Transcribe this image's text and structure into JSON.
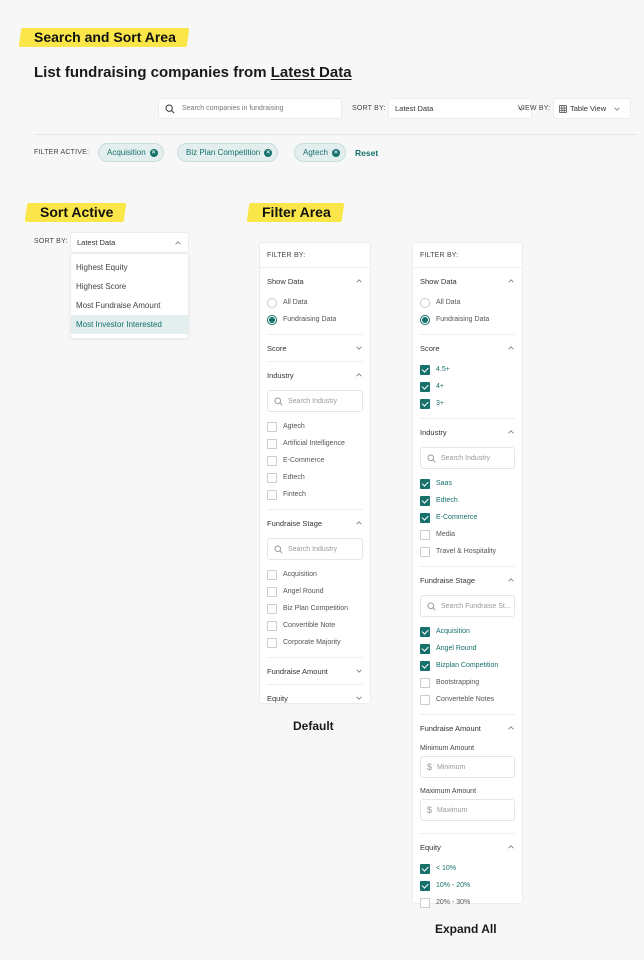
{
  "sections": {
    "search_sort_title": "Search and Sort Area",
    "sort_active_title": "Sort Active",
    "filter_area_title": "Filter Area"
  },
  "heading": {
    "prefix": "List fundraising companies from ",
    "link": "Latest Data"
  },
  "toolbar": {
    "search_placeholder": "Search companies in fundraising",
    "sort_label": "SORT BY:",
    "sort_value": "Latest Data",
    "view_label": "VIEW BY:",
    "view_value": "Table View"
  },
  "active_filters": {
    "label": "FILTER ACTIVE:",
    "chips": [
      "Acquisition",
      "Biz Plan Competition",
      "Agtech"
    ],
    "reset_label": "Reset"
  },
  "sort_active": {
    "label": "SORT BY:",
    "value": "Latest Data",
    "options": [
      "Highest Equity",
      "Highest Score",
      "Most Fundraise Amount",
      "Most Investor Interested"
    ],
    "selected_index": 3
  },
  "filter_default": {
    "header": "FILTER BY:",
    "show_data": {
      "title": "Show Data",
      "options": [
        "All Data",
        "Fundraising Data"
      ],
      "selected": 1
    },
    "score": {
      "title": "Score"
    },
    "industry": {
      "title": "Industry",
      "search_placeholder": "Search Industry",
      "options": [
        "Agtech",
        "Artificial Intelligence",
        "E-Commerce",
        "Edtech",
        "Fintech"
      ]
    },
    "fundraise_stage": {
      "title": "Fundraise Stage",
      "search_placeholder": "Search Industry",
      "options": [
        "Acquisition",
        "Angel Round",
        "Biz Plan Competition",
        "Convertible Note",
        "Corporate Majority"
      ]
    },
    "fundraise_amount": {
      "title": "Fundraise Amount"
    },
    "equity": {
      "title": "Equity"
    },
    "caption": "Default"
  },
  "filter_expanded": {
    "header": "FILTER BY:",
    "show_data": {
      "title": "Show Data",
      "options": [
        "All Data",
        "Fundraising Data"
      ],
      "selected": 1
    },
    "score": {
      "title": "Score",
      "options": [
        "4.5+",
        "4+",
        "3+"
      ],
      "checked": [
        true,
        true,
        true
      ]
    },
    "industry": {
      "title": "Industry",
      "search_placeholder": "Search Industry",
      "options": [
        "Saas",
        "Edtech",
        "E-Commerce",
        "Media",
        "Travel & Hospitality"
      ],
      "checked": [
        true,
        true,
        true,
        false,
        false
      ]
    },
    "fundraise_stage": {
      "title": "Fundraise Stage",
      "search_placeholder": "Search Fundraise St...",
      "options": [
        "Acquisition",
        "Angel Round",
        "Bizplan Competition",
        "Bootstrapping",
        "Converteble Notes"
      ],
      "checked": [
        true,
        true,
        true,
        false,
        false
      ]
    },
    "fundraise_amount": {
      "title": "Fundraise Amount",
      "min_label": "Minimum Amount",
      "min_placeholder": "Minimum",
      "max_label": "Maximum Amount",
      "max_placeholder": "Maximum",
      "currency_symbol": "$"
    },
    "equity": {
      "title": "Equity",
      "options": [
        "< 10%",
        "10% - 20%",
        "20% - 30%"
      ],
      "checked": [
        true,
        true,
        false
      ]
    },
    "caption": "Expand All"
  },
  "colors": {
    "accent": "#16706b",
    "chip_bg": "#e2efee",
    "highlight": "#fbe64a",
    "background": "#f7f7f7"
  }
}
